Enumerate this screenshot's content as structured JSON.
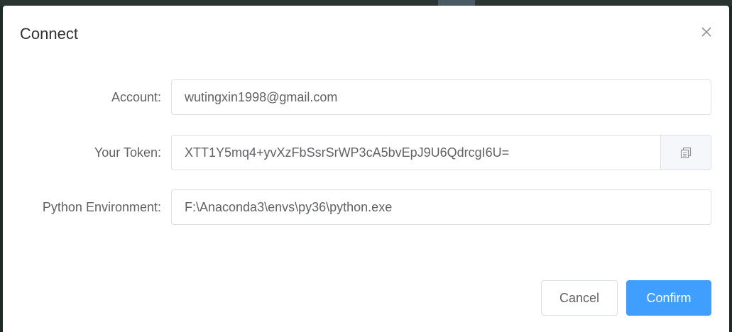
{
  "dialog": {
    "title": "Connect"
  },
  "form": {
    "account": {
      "label": "Account:",
      "value": "wutingxin1998@gmail.com"
    },
    "token": {
      "label": "Your Token:",
      "value": "XTT1Y5mq4+yvXzFbSsrSrWP3cA5bvEpJ9U6QdrcgI6U=",
      "append_icon": "copy-icon"
    },
    "python_env": {
      "label": "Python Environment:",
      "value": "F:\\Anaconda3\\envs\\py36\\python.exe"
    }
  },
  "footer": {
    "cancel_label": "Cancel",
    "confirm_label": "Confirm"
  },
  "colors": {
    "primary": "#409eff",
    "label_text": "#606266",
    "border": "#dcdfe6",
    "title_text": "#303133"
  }
}
